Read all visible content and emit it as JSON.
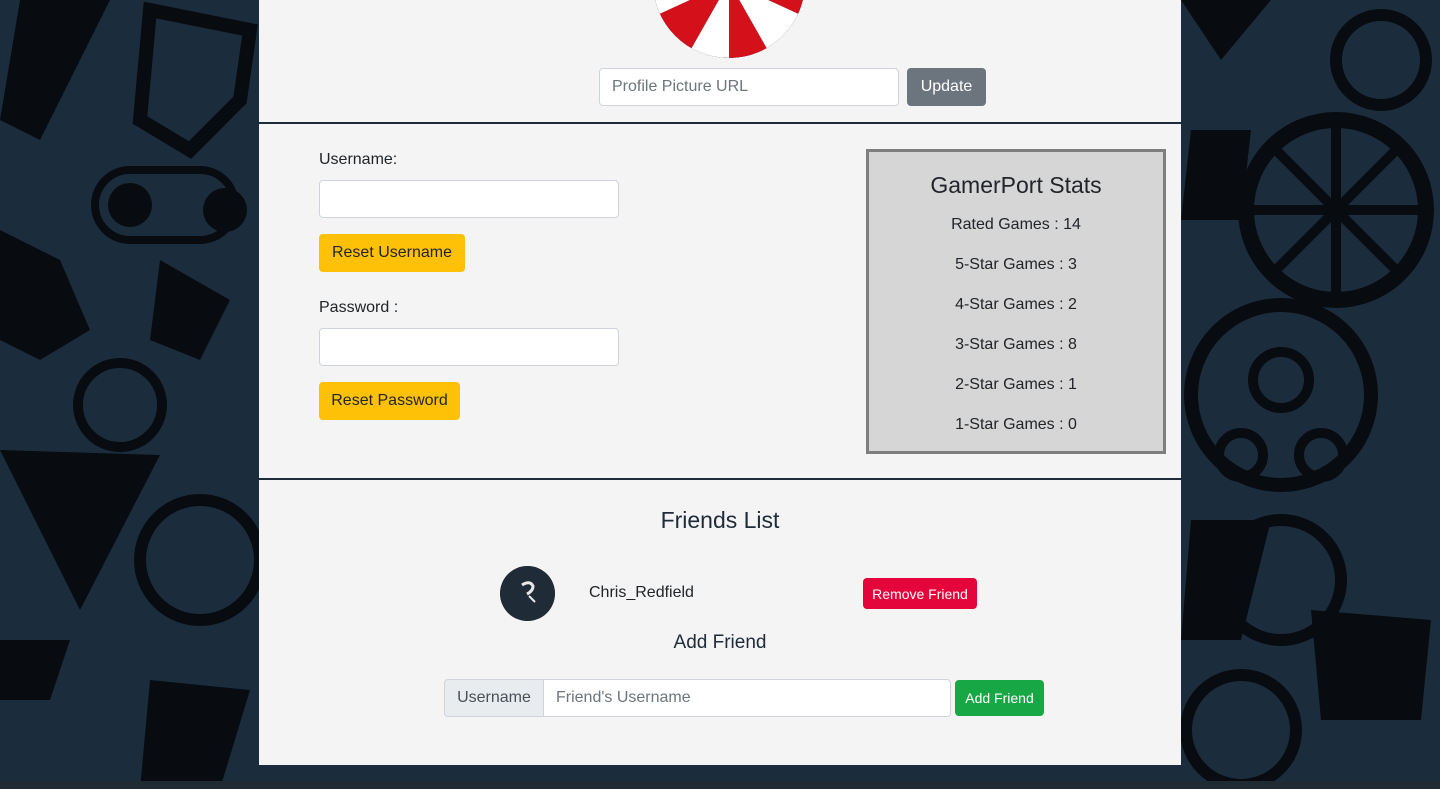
{
  "profile": {
    "picture_placeholder": "Profile Picture URL",
    "update_label": "Update"
  },
  "account": {
    "username_label": "Username:",
    "reset_username_label": "Reset Username",
    "password_label": "Password :",
    "reset_password_label": "Reset Password"
  },
  "stats": {
    "title": "GamerPort Stats",
    "lines": [
      "Rated Games : 14",
      "5-Star Games : 3",
      "4-Star Games : 2",
      "3-Star Games : 8",
      "2-Star Games : 1",
      "1-Star Games : 0"
    ]
  },
  "friends": {
    "title": "Friends List",
    "items": [
      {
        "name": "Chris_Redfield",
        "remove_label": "Remove Friend"
      }
    ]
  },
  "add_friend": {
    "title": "Add Friend",
    "addon_label": "Username",
    "placeholder": "Friend's Username",
    "button_label": "Add Friend"
  },
  "colors": {
    "background": "#1b2d3d",
    "panel": "#f4f4f4",
    "warning": "#ffc107",
    "danger": "#e4053a",
    "success": "#17a745",
    "secondary": "#6c757d"
  }
}
